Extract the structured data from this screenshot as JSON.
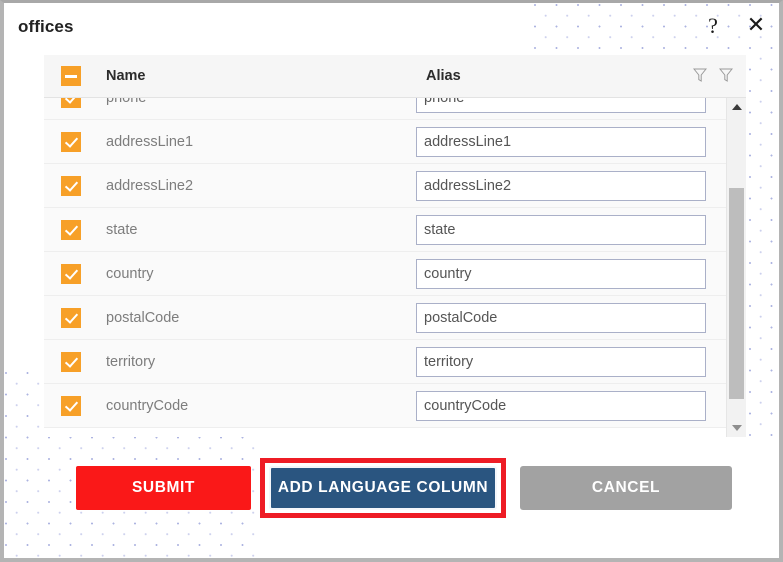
{
  "dialog": {
    "title": "offices",
    "help_icon_glyph": "?",
    "help_icon_name": "help-icon",
    "close_icon_glyph": "✕",
    "close_icon_name": "close-icon"
  },
  "grid": {
    "columns": [
      {
        "label": "Name",
        "filter_icon": "filter-funnel-icon"
      },
      {
        "label": "Alias",
        "filter_icon": "filter-funnel-icon"
      }
    ],
    "select_all_state": "indeterminate",
    "rows": [
      {
        "checked": true,
        "name": "phone",
        "alias": "phone"
      },
      {
        "checked": true,
        "name": "addressLine1",
        "alias": "addressLine1"
      },
      {
        "checked": true,
        "name": "addressLine2",
        "alias": "addressLine2"
      },
      {
        "checked": true,
        "name": "state",
        "alias": "state"
      },
      {
        "checked": true,
        "name": "country",
        "alias": "country"
      },
      {
        "checked": true,
        "name": "postalCode",
        "alias": "postalCode"
      },
      {
        "checked": true,
        "name": "territory",
        "alias": "territory"
      },
      {
        "checked": true,
        "name": "countryCode",
        "alias": "countryCode"
      }
    ],
    "scrollbar": {
      "up_arrow_icon": "scroll-up-arrow-icon",
      "down_arrow_icon": "scroll-down-arrow-icon"
    }
  },
  "buttons": {
    "submit": "SUBMIT",
    "add_language_column": "ADD LANGUAGE COLUMN",
    "cancel": "CANCEL"
  },
  "colors": {
    "submit_red": "#fa1818",
    "add_language_blue": "#2a5580",
    "cancel_gray": "#a2a2a2",
    "highlight_red": "#ee1c25",
    "checkbox_orange": "#f7a028",
    "dot_pattern": "#a9b0e0"
  }
}
